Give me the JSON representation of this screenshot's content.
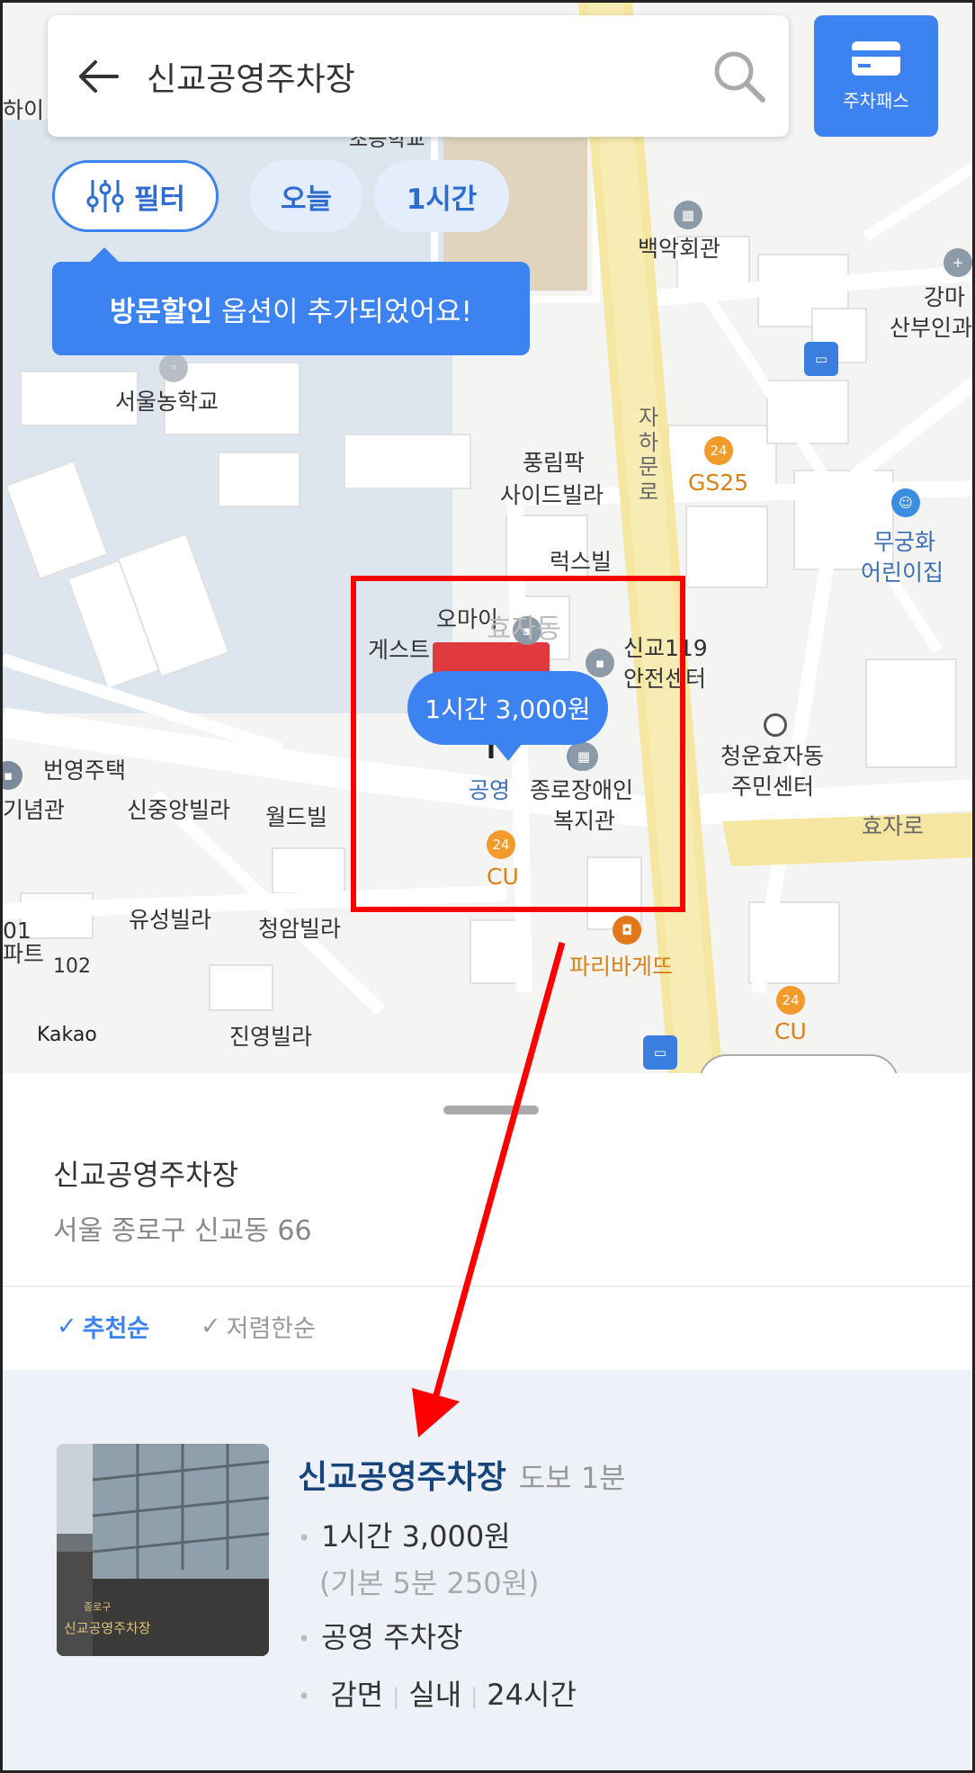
{
  "search": {
    "query": "신교공영주차장"
  },
  "pass_button": {
    "label": "주차패스"
  },
  "chips": {
    "filter": "필터",
    "today": "오늘",
    "duration": "1시간"
  },
  "tooltip": {
    "bold": "방문할인",
    "rest": " 옵션이 추가되었어요!"
  },
  "map": {
    "labels": {
      "school_top": "초등학교",
      "baekak": "백악회관",
      "gangma": "강마",
      "sanbu": "산부인과",
      "seoul_school": "서울농학교",
      "jaharo": "자하문로",
      "punglim1": "풍림팍",
      "punglim2": "사이드빌라",
      "gs25": "GS25",
      "mugunghwa1": "무궁화",
      "mugunghwa2": "어린이집",
      "luxvill": "럭스빌",
      "omai1": "오마이",
      "omai2": "게스트",
      "hyoja_faint": "효자동",
      "fire1": "신교119",
      "fire2": "안전센터",
      "cheongun1": "청운효자동",
      "cheongun2": "주민센터",
      "hyojaro": "효자로",
      "beonyoung": "번영주택",
      "nyeomgwan": "기념관",
      "sinjungang": "신중앙빌라",
      "worldvill": "월드빌",
      "gongyoung": "공영",
      "jangae1": "종로장애인",
      "jangae2": "복지관",
      "cu1": "CU",
      "yuseong": "유성빌라",
      "cheongam": "청암빌라",
      "apt1": "01",
      "apt2": "파트",
      "apt3": "102",
      "paris": "파리바게뜨",
      "cu2": "CU",
      "kakao": "Kakao",
      "jinyoung": "진영빌라",
      "left_top": "하이"
    },
    "price_bubble": "1시간 3,000원"
  },
  "sheet": {
    "name": "신교공영주차장",
    "address": "서울 종로구 신교동 66",
    "sort_recommended": "추천순",
    "sort_cheapest": "저렴한순",
    "card": {
      "title": "신교공영주차장",
      "walk": "도보 1분",
      "price": "1시간 3,000원",
      "base_price": "(기본 5분 250원)",
      "type": "공영 주차장",
      "tag1": "감면",
      "tag2": "실내",
      "tag3": "24시간",
      "thumb_sign": "신교공영주차장",
      "thumb_sign_top": "종로구"
    }
  },
  "colors": {
    "accent": "#3c82f0",
    "highlight": "#ff0000",
    "road_yellow": "#f5e7a1"
  }
}
